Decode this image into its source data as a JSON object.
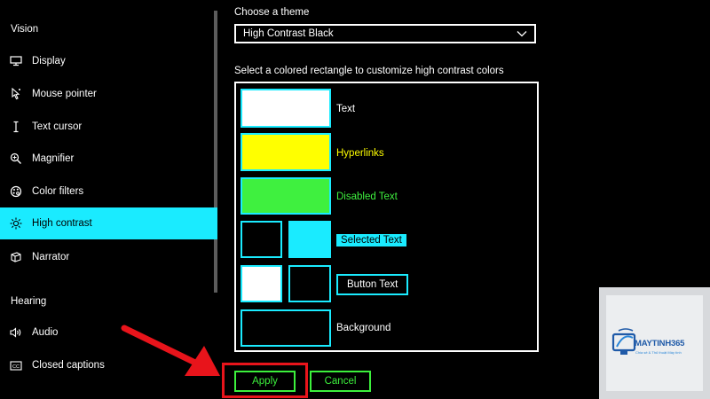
{
  "sidebar": {
    "sections": {
      "vision": "Vision",
      "hearing": "Hearing"
    },
    "items": [
      {
        "label": "Display",
        "icon": "monitor-icon"
      },
      {
        "label": "Mouse pointer",
        "icon": "mouse-pointer-icon"
      },
      {
        "label": "Text cursor",
        "icon": "text-cursor-icon"
      },
      {
        "label": "Magnifier",
        "icon": "magnifier-icon"
      },
      {
        "label": "Color filters",
        "icon": "color-filters-icon"
      },
      {
        "label": "High contrast",
        "icon": "high-contrast-icon",
        "active": true
      },
      {
        "label": "Narrator",
        "icon": "narrator-icon"
      },
      {
        "label": "Audio",
        "icon": "speaker-icon"
      },
      {
        "label": "Closed captions",
        "icon": "closed-captions-icon"
      }
    ]
  },
  "main": {
    "theme_label": "Choose a theme",
    "theme_value": "High Contrast Black",
    "colors_label": "Select a colored rectangle to customize high contrast colors",
    "rows": {
      "text": "Text",
      "hyperlinks": "Hyperlinks",
      "disabled_text": "Disabled Text",
      "selected_text": "Selected Text",
      "button_text": "Button Text",
      "background": "Background"
    },
    "apply_label": "Apply",
    "cancel_label": "Cancel"
  },
  "watermark": {
    "brand": "MAYTINH365",
    "tagline": "Chia sẻ & Thủ thuật Máy tính"
  },
  "colors": {
    "accent": "#1aebff",
    "hyperlink": "#ffff00",
    "disabled": "#3ff03f",
    "selected_bg": "#1aebff",
    "button_border": "#3cf03c",
    "annotation_red": "#e8141b"
  }
}
